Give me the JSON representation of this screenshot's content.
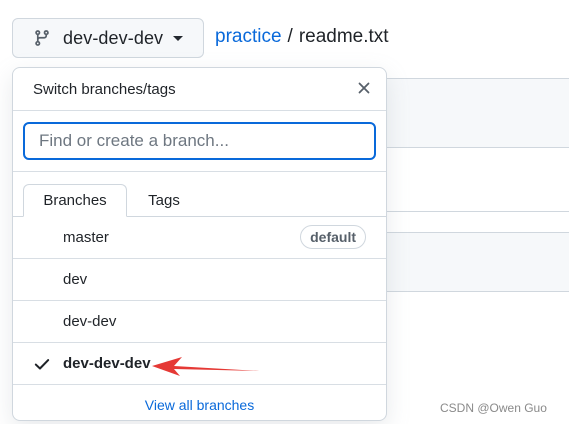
{
  "header": {
    "current_branch": "dev-dev-dev",
    "branch_icon": "git-branch-icon",
    "breadcrumb": {
      "repo": "practice",
      "separator": "/",
      "file": "readme.txt"
    }
  },
  "dropdown": {
    "title": "Switch branches/tags",
    "close_icon": "close-icon",
    "filter_placeholder": "Find or create a branch...",
    "filter_value": "",
    "tabs": [
      {
        "label": "Branches",
        "active": true
      },
      {
        "label": "Tags",
        "active": false
      }
    ],
    "branches": [
      {
        "name": "master",
        "badge": "default",
        "selected": false
      },
      {
        "name": "dev",
        "badge": "",
        "selected": false
      },
      {
        "name": "dev-dev",
        "badge": "",
        "selected": false
      },
      {
        "name": "dev-dev-dev",
        "badge": "",
        "selected": true
      }
    ],
    "footer_link": "View all branches"
  },
  "annotation": {
    "arrow_color": "#e53935"
  },
  "watermark": "CSDN @Owen Guo",
  "colors": {
    "link": "#0969da",
    "border": "#d0d7de",
    "text": "#1f2328",
    "muted": "#57606a"
  }
}
